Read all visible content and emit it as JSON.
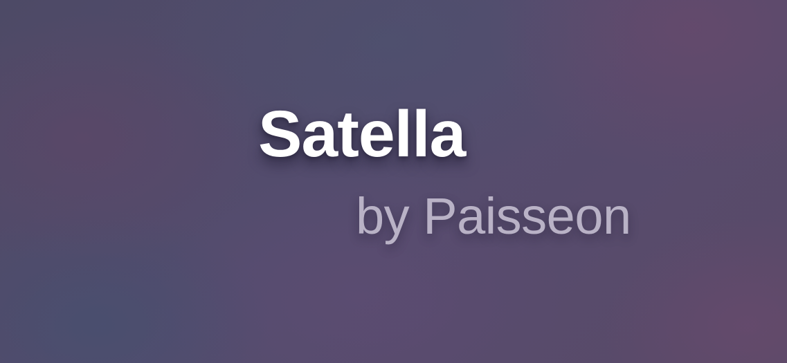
{
  "splash": {
    "title": "Satella",
    "byline": "by Paisseon"
  },
  "colors": {
    "title": "#ffffff",
    "byline": "#b9b2c6",
    "background": "#524b6b"
  }
}
